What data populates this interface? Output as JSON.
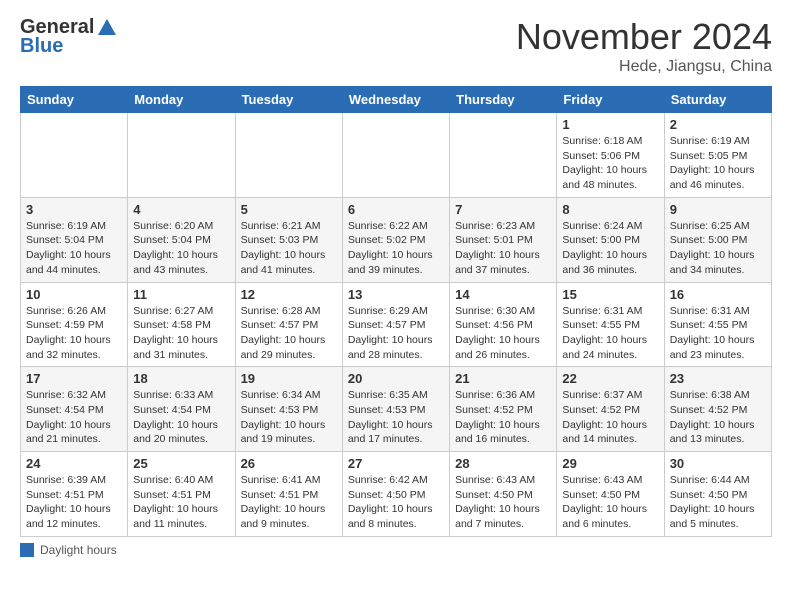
{
  "header": {
    "logo_general": "General",
    "logo_blue": "Blue",
    "title": "November 2024",
    "location": "Hede, Jiangsu, China"
  },
  "days_of_week": [
    "Sunday",
    "Monday",
    "Tuesday",
    "Wednesday",
    "Thursday",
    "Friday",
    "Saturday"
  ],
  "legend": {
    "daylight_label": "Daylight hours"
  },
  "weeks": [
    [
      {
        "day": "",
        "info": ""
      },
      {
        "day": "",
        "info": ""
      },
      {
        "day": "",
        "info": ""
      },
      {
        "day": "",
        "info": ""
      },
      {
        "day": "",
        "info": ""
      },
      {
        "day": "1",
        "info": "Sunrise: 6:18 AM\nSunset: 5:06 PM\nDaylight: 10 hours and 48 minutes."
      },
      {
        "day": "2",
        "info": "Sunrise: 6:19 AM\nSunset: 5:05 PM\nDaylight: 10 hours and 46 minutes."
      }
    ],
    [
      {
        "day": "3",
        "info": "Sunrise: 6:19 AM\nSunset: 5:04 PM\nDaylight: 10 hours and 44 minutes."
      },
      {
        "day": "4",
        "info": "Sunrise: 6:20 AM\nSunset: 5:04 PM\nDaylight: 10 hours and 43 minutes."
      },
      {
        "day": "5",
        "info": "Sunrise: 6:21 AM\nSunset: 5:03 PM\nDaylight: 10 hours and 41 minutes."
      },
      {
        "day": "6",
        "info": "Sunrise: 6:22 AM\nSunset: 5:02 PM\nDaylight: 10 hours and 39 minutes."
      },
      {
        "day": "7",
        "info": "Sunrise: 6:23 AM\nSunset: 5:01 PM\nDaylight: 10 hours and 37 minutes."
      },
      {
        "day": "8",
        "info": "Sunrise: 6:24 AM\nSunset: 5:00 PM\nDaylight: 10 hours and 36 minutes."
      },
      {
        "day": "9",
        "info": "Sunrise: 6:25 AM\nSunset: 5:00 PM\nDaylight: 10 hours and 34 minutes."
      }
    ],
    [
      {
        "day": "10",
        "info": "Sunrise: 6:26 AM\nSunset: 4:59 PM\nDaylight: 10 hours and 32 minutes."
      },
      {
        "day": "11",
        "info": "Sunrise: 6:27 AM\nSunset: 4:58 PM\nDaylight: 10 hours and 31 minutes."
      },
      {
        "day": "12",
        "info": "Sunrise: 6:28 AM\nSunset: 4:57 PM\nDaylight: 10 hours and 29 minutes."
      },
      {
        "day": "13",
        "info": "Sunrise: 6:29 AM\nSunset: 4:57 PM\nDaylight: 10 hours and 28 minutes."
      },
      {
        "day": "14",
        "info": "Sunrise: 6:30 AM\nSunset: 4:56 PM\nDaylight: 10 hours and 26 minutes."
      },
      {
        "day": "15",
        "info": "Sunrise: 6:31 AM\nSunset: 4:55 PM\nDaylight: 10 hours and 24 minutes."
      },
      {
        "day": "16",
        "info": "Sunrise: 6:31 AM\nSunset: 4:55 PM\nDaylight: 10 hours and 23 minutes."
      }
    ],
    [
      {
        "day": "17",
        "info": "Sunrise: 6:32 AM\nSunset: 4:54 PM\nDaylight: 10 hours and 21 minutes."
      },
      {
        "day": "18",
        "info": "Sunrise: 6:33 AM\nSunset: 4:54 PM\nDaylight: 10 hours and 20 minutes."
      },
      {
        "day": "19",
        "info": "Sunrise: 6:34 AM\nSunset: 4:53 PM\nDaylight: 10 hours and 19 minutes."
      },
      {
        "day": "20",
        "info": "Sunrise: 6:35 AM\nSunset: 4:53 PM\nDaylight: 10 hours and 17 minutes."
      },
      {
        "day": "21",
        "info": "Sunrise: 6:36 AM\nSunset: 4:52 PM\nDaylight: 10 hours and 16 minutes."
      },
      {
        "day": "22",
        "info": "Sunrise: 6:37 AM\nSunset: 4:52 PM\nDaylight: 10 hours and 14 minutes."
      },
      {
        "day": "23",
        "info": "Sunrise: 6:38 AM\nSunset: 4:52 PM\nDaylight: 10 hours and 13 minutes."
      }
    ],
    [
      {
        "day": "24",
        "info": "Sunrise: 6:39 AM\nSunset: 4:51 PM\nDaylight: 10 hours and 12 minutes."
      },
      {
        "day": "25",
        "info": "Sunrise: 6:40 AM\nSunset: 4:51 PM\nDaylight: 10 hours and 11 minutes."
      },
      {
        "day": "26",
        "info": "Sunrise: 6:41 AM\nSunset: 4:51 PM\nDaylight: 10 hours and 9 minutes."
      },
      {
        "day": "27",
        "info": "Sunrise: 6:42 AM\nSunset: 4:50 PM\nDaylight: 10 hours and 8 minutes."
      },
      {
        "day": "28",
        "info": "Sunrise: 6:43 AM\nSunset: 4:50 PM\nDaylight: 10 hours and 7 minutes."
      },
      {
        "day": "29",
        "info": "Sunrise: 6:43 AM\nSunset: 4:50 PM\nDaylight: 10 hours and 6 minutes."
      },
      {
        "day": "30",
        "info": "Sunrise: 6:44 AM\nSunset: 4:50 PM\nDaylight: 10 hours and 5 minutes."
      }
    ]
  ]
}
